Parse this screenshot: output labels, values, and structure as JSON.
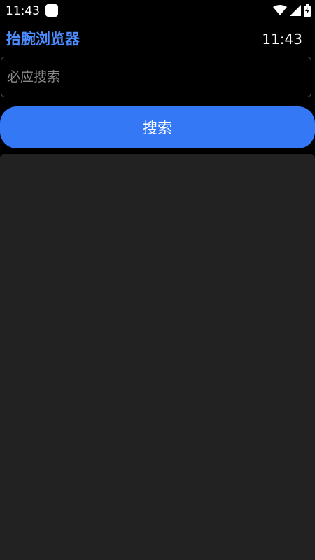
{
  "status_bar": {
    "time": "11:43",
    "icons": [
      "app-notification-icon",
      "wifi-icon",
      "cellular-signal-icon",
      "battery-charging-icon"
    ]
  },
  "header": {
    "title": "抬腕浏览器",
    "clock": "11:43"
  },
  "search": {
    "placeholder": "必应搜索",
    "value": "",
    "button_label": "搜索"
  },
  "colors": {
    "accent": "#3478f6",
    "title": "#4d8dff",
    "background": "#000000",
    "panel": "#222222"
  }
}
